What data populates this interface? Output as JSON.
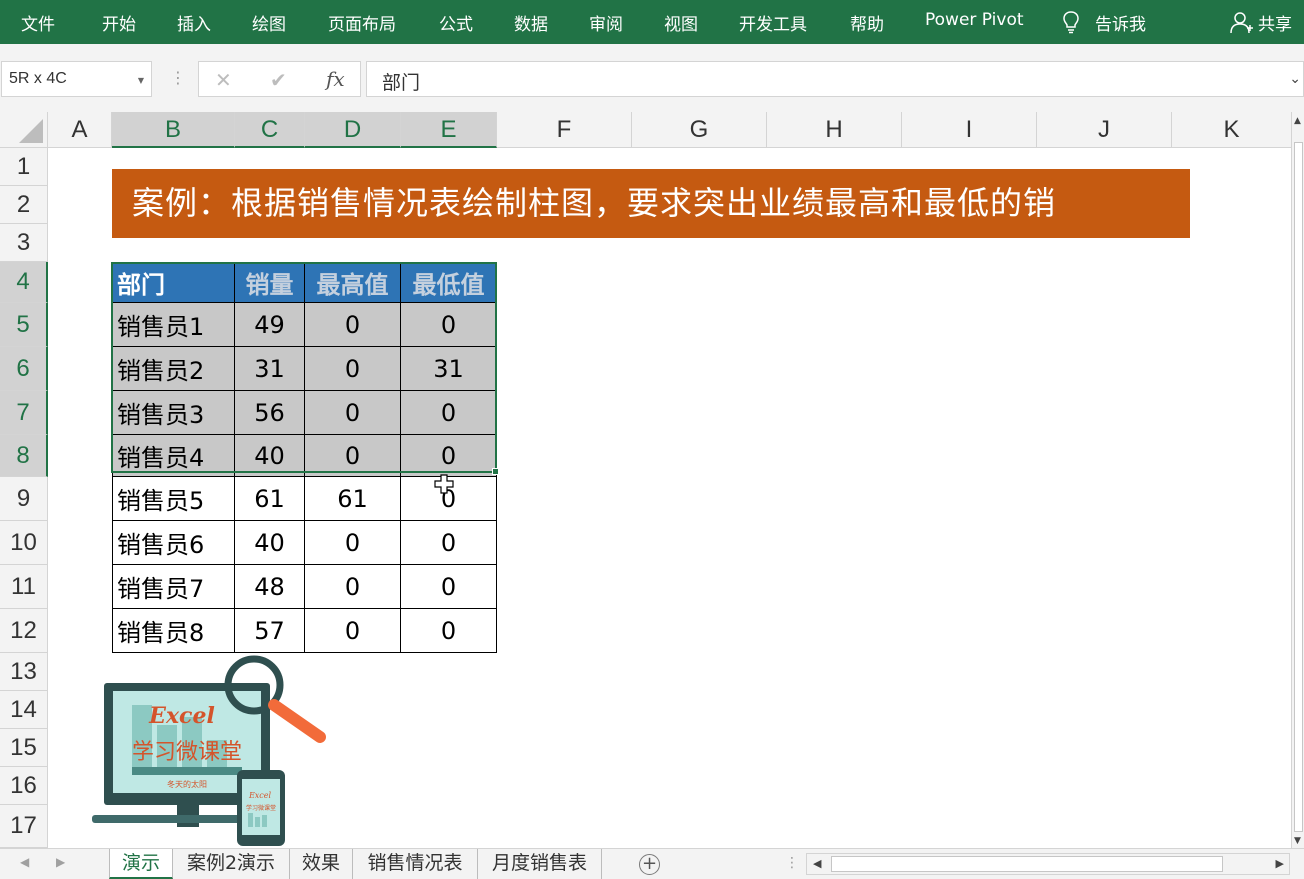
{
  "ribbon": {
    "tabs": [
      "文件",
      "开始",
      "插入",
      "绘图",
      "页面布局",
      "公式",
      "数据",
      "审阅",
      "视图",
      "开发工具",
      "帮助",
      "Power Pivot"
    ],
    "tell_me": "告诉我",
    "share": "共享",
    "icons": {
      "tell_me": "lightbulb-icon",
      "share": "person-icon"
    }
  },
  "formula_bar": {
    "name_box": "5R x 4C",
    "cancel_icon": "✕",
    "enter_icon": "✔",
    "fx_label": "fx",
    "formula": "部门"
  },
  "columns": [
    "A",
    "B",
    "C",
    "D",
    "E",
    "F",
    "G",
    "H",
    "I",
    "J",
    "K"
  ],
  "selected_columns": [
    "B",
    "C",
    "D",
    "E"
  ],
  "rows": [
    "1",
    "2",
    "3",
    "4",
    "5",
    "6",
    "7",
    "8",
    "9",
    "10",
    "11",
    "12",
    "13",
    "14",
    "15",
    "16",
    "17"
  ],
  "selected_rows": [
    "4",
    "5",
    "6",
    "7",
    "8"
  ],
  "banner": {
    "text": "案例：根据销售情况表绘制柱图，要求突出业绩最高和最低的销",
    "color": "#c55a11"
  },
  "table": {
    "headers": [
      "部门",
      "销量",
      "最高值",
      "最低值"
    ],
    "rows": [
      [
        "销售员1",
        "49",
        "0",
        "0"
      ],
      [
        "销售员2",
        "31",
        "0",
        "31"
      ],
      [
        "销售员3",
        "56",
        "0",
        "0"
      ],
      [
        "销售员4",
        "40",
        "0",
        "0"
      ],
      [
        "销售员5",
        "61",
        "61",
        "0"
      ],
      [
        "销售员6",
        "40",
        "0",
        "0"
      ],
      [
        "销售员7",
        "48",
        "0",
        "0"
      ],
      [
        "销售员8",
        "57",
        "0",
        "0"
      ]
    ],
    "header_color": "#2e74b5",
    "selection_color": "#217346"
  },
  "logo": {
    "line1": "Excel",
    "line2": "学习微课堂",
    "line3": "冬天的太阳",
    "small1": "Excel",
    "small2": "学习微课堂"
  },
  "sheet_tabs": [
    "演示",
    "案例2演示",
    "效果",
    "销售情况表",
    "月度销售表"
  ],
  "active_sheet": "演示",
  "add_sheet": "+",
  "accent_color": "#217346"
}
